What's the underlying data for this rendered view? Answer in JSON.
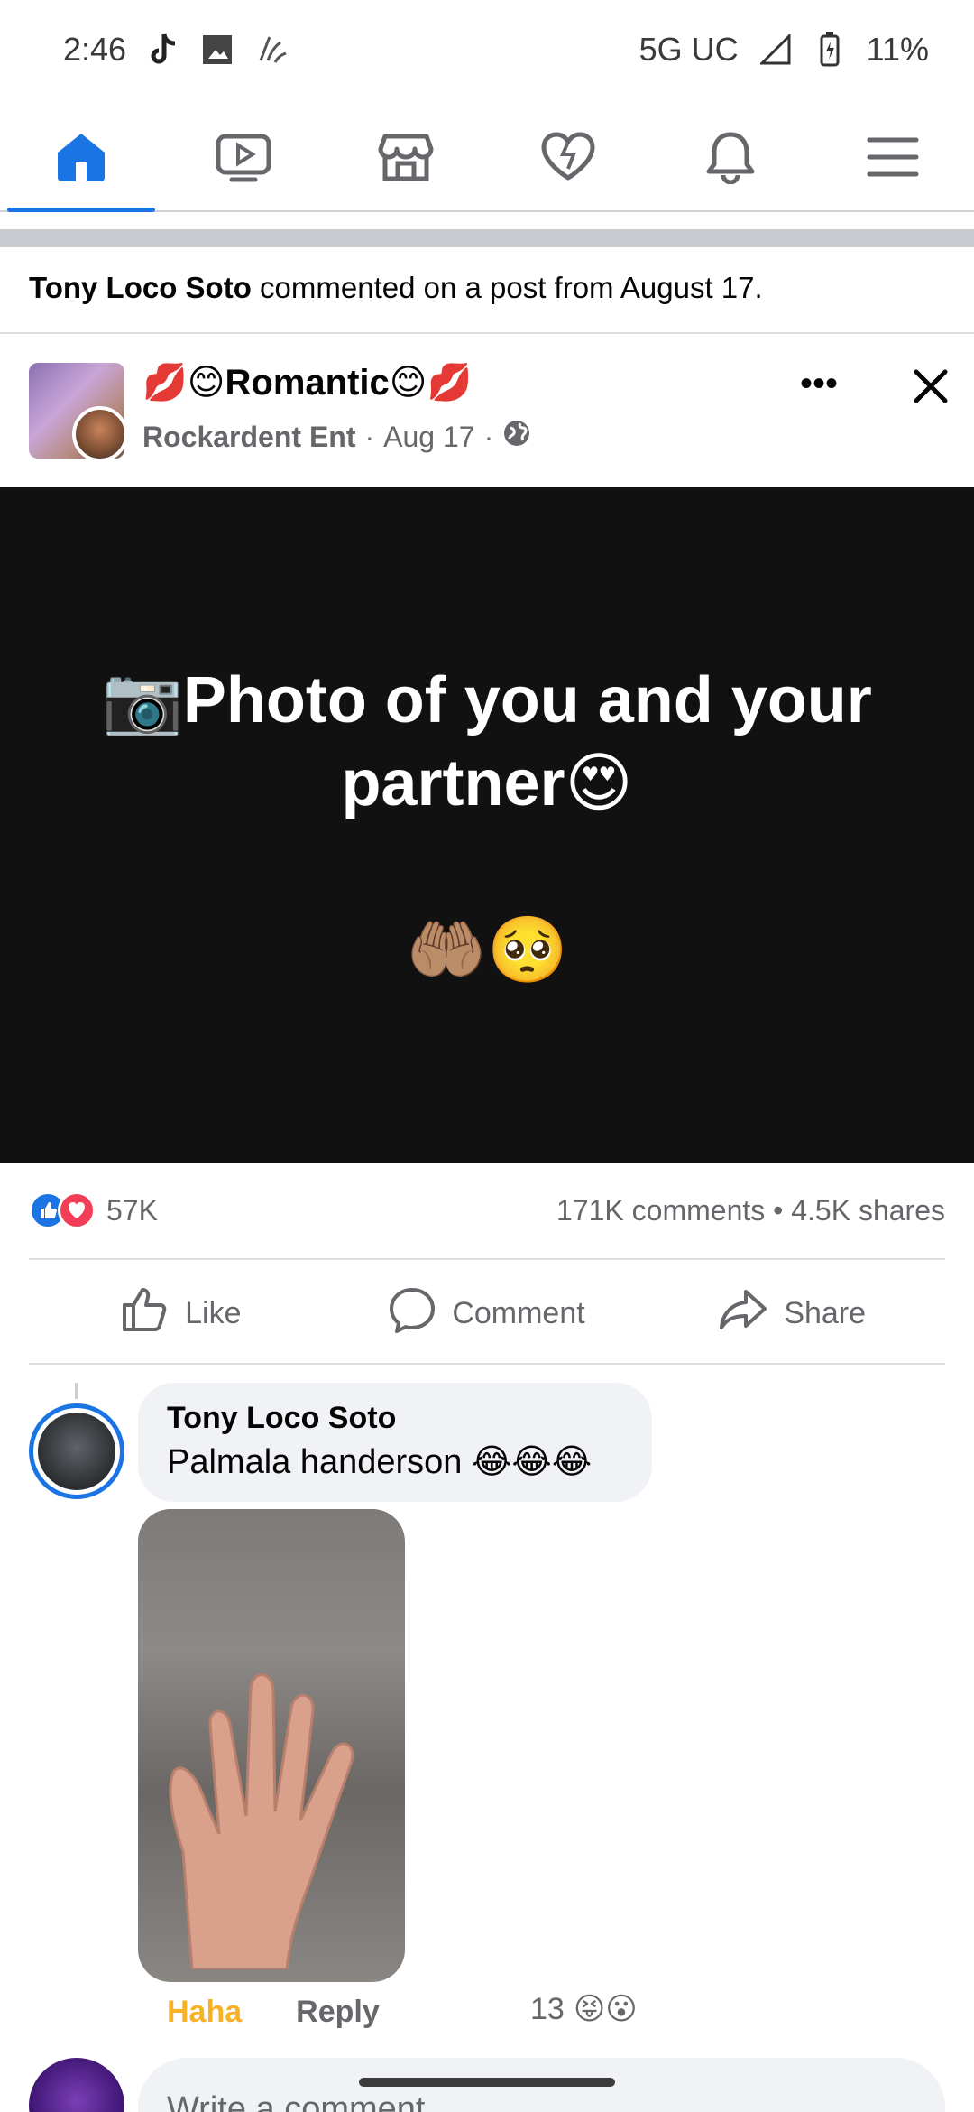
{
  "status_bar": {
    "time": "2:46",
    "network": "5G UC",
    "battery": "11%",
    "icons": [
      "tiktok-icon",
      "gallery-icon",
      "app-icon",
      "signal-icon",
      "battery-icon"
    ]
  },
  "nav": {
    "tabs": [
      {
        "name": "home",
        "icon": "home-icon",
        "active": true
      },
      {
        "name": "video",
        "icon": "video-icon",
        "active": false
      },
      {
        "name": "marketplace",
        "icon": "store-icon",
        "active": false
      },
      {
        "name": "dating",
        "icon": "heart-icon",
        "active": false
      },
      {
        "name": "notifications",
        "icon": "bell-icon",
        "active": false
      },
      {
        "name": "menu",
        "icon": "hamburger-icon",
        "active": false
      }
    ],
    "accent_color": "#1b74e4"
  },
  "activity": {
    "actor": "Tony Loco Soto",
    "text": " commented on a post from August 17."
  },
  "post": {
    "title": "💋😊Romantic😊💋",
    "page_name": "Rockardent Ent",
    "date": "Aug 17",
    "more_label": "•••",
    "body_text": "📷Photo of you and your partner😍",
    "body_emojis": "🤲🏽🥺"
  },
  "engagement": {
    "reactions_count": "57K",
    "comments_shares": "171K comments • 4.5K shares"
  },
  "actions": {
    "like": "Like",
    "comment": "Comment",
    "share": "Share"
  },
  "comment": {
    "author": "Tony Loco Soto",
    "text": "Palmala handerson 😂😂😂",
    "reaction_label": "Haha",
    "reply_label": "Reply",
    "reaction_count": "13",
    "reaction_emojis": "😝😮"
  },
  "composer": {
    "placeholder": "Write a comment..."
  }
}
